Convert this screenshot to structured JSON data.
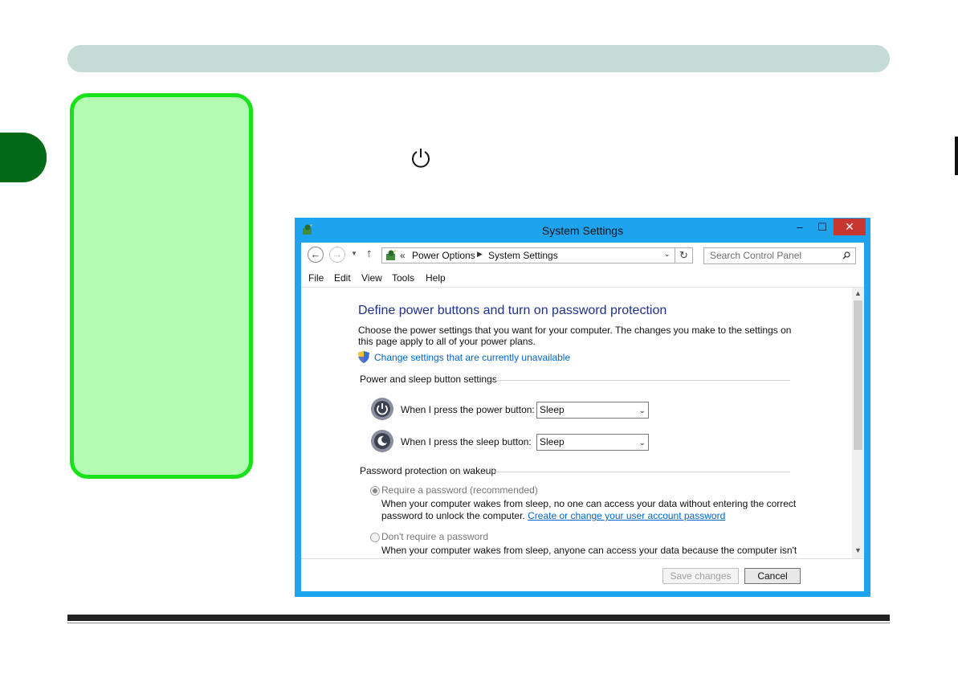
{
  "window": {
    "title": "System Settings",
    "min_glyph": "–",
    "max_glyph": "☐",
    "close_glyph": "✕"
  },
  "nav": {
    "back_glyph": "←",
    "forward_glyph": "→",
    "recent_glyph": "▼",
    "up_glyph": "↑",
    "address_prefix": "«",
    "breadcrumbs": [
      "Power Options",
      "System Settings"
    ],
    "crumb_separator": "▶",
    "dropdown_glyph": "⌄",
    "refresh_glyph": "↻",
    "search_placeholder": "Search Control Panel"
  },
  "menu": [
    "File",
    "Edit",
    "View",
    "Tools",
    "Help"
  ],
  "content": {
    "heading": "Define power buttons and turn on password protection",
    "description": "Choose the power settings that you want for your computer. The changes you make to the settings on this page apply to all of your power plans.",
    "change_link": "Change settings that are currently unavailable",
    "power_section_title": "Power and sleep button settings",
    "power_rows": [
      {
        "label": "When I press the power button:",
        "value": "Sleep"
      },
      {
        "label": "When I press the sleep button:",
        "value": "Sleep"
      }
    ],
    "password_section_title": "Password protection on wakeup",
    "require_password": {
      "label": "Require a password (recommended)",
      "text_line1": "When your computer wakes from sleep, no one can access your data without entering the correct",
      "text_line2_prefix": "password to unlock the computer. ",
      "link": "Create or change your user account password",
      "selected": true
    },
    "no_password": {
      "label": "Don't require a password",
      "text_line1": "When your computer wakes from sleep, anyone can access your data because the computer isn't",
      "selected": false
    }
  },
  "buttons": {
    "save": "Save changes",
    "cancel": "Cancel"
  },
  "colors": {
    "window_frame": "#1ea3ef",
    "close_button": "#c7372f",
    "heading_blue": "#1e3287",
    "link_blue": "#0066cc",
    "sidebar_fill": "#b4fcb4",
    "sidebar_border": "#1ae21a",
    "chapter_tab": "#006a19",
    "header_bar": "#c5dcd6"
  },
  "icons": {
    "page_power": "power-icon",
    "app": "power-options-icon",
    "shield": "uac-shield-icon",
    "search": "search-icon"
  }
}
